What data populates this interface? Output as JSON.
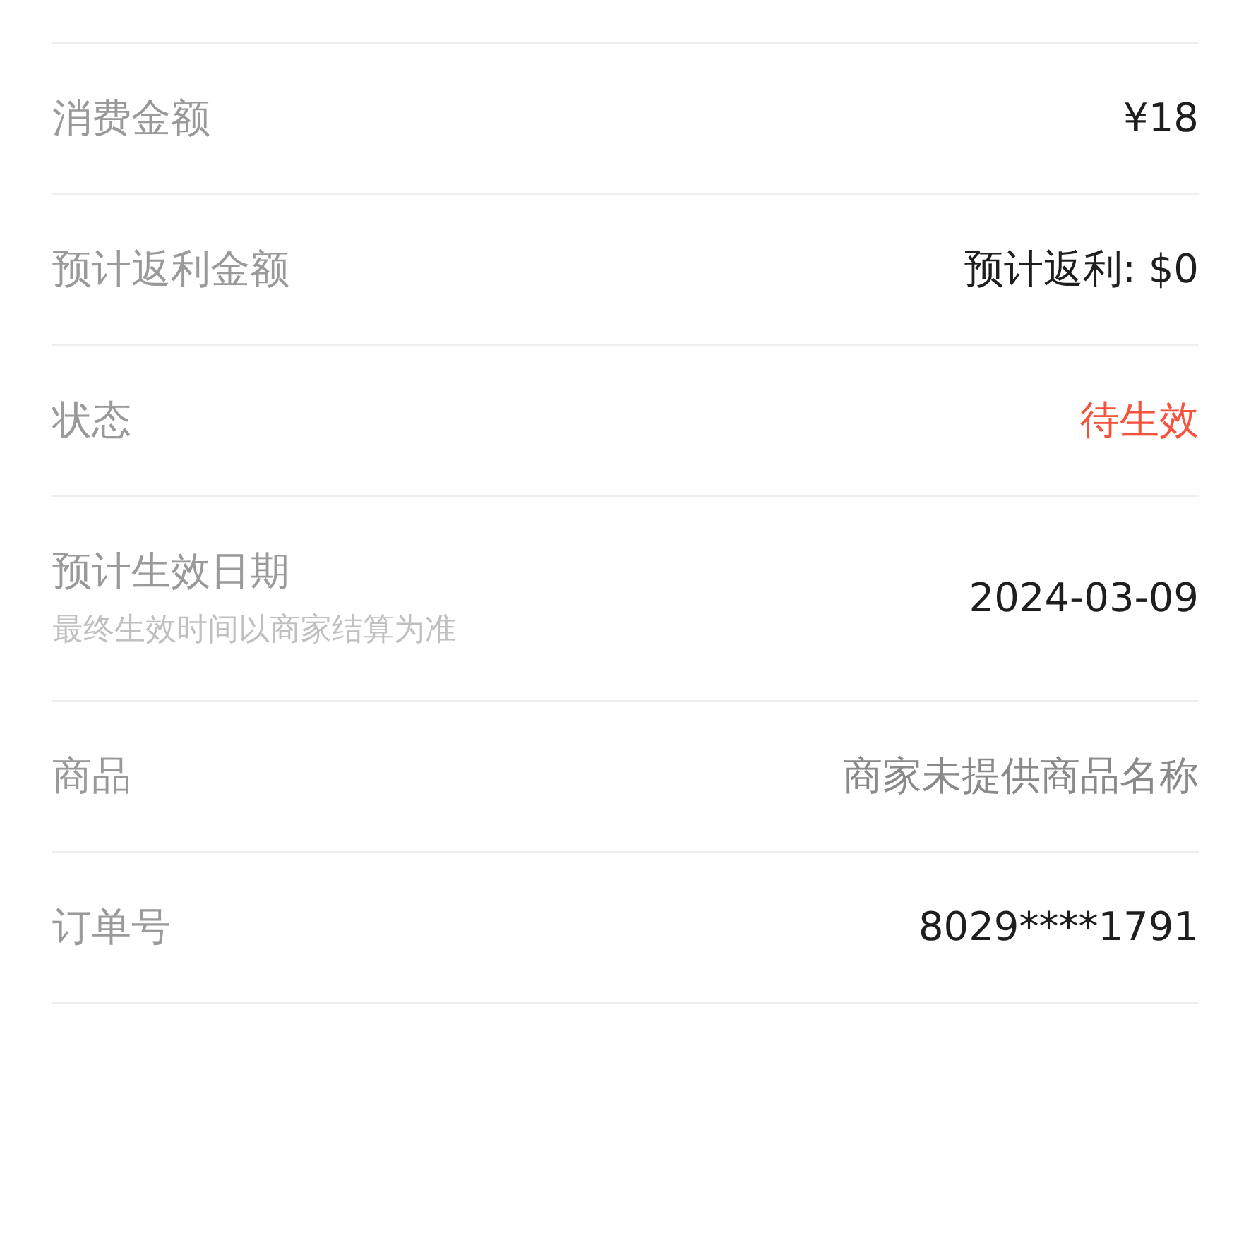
{
  "rows": [
    {
      "label": "消费金额",
      "value": "¥18",
      "kind": "plain"
    },
    {
      "label": "预计返利金额",
      "value": "预计返利: $0",
      "kind": "plain"
    },
    {
      "label": "状态",
      "value": "待生效",
      "kind": "alert"
    },
    {
      "label": "预计生效日期",
      "note": "最终生效时间以商家结算为准",
      "value": "2024-03-09",
      "kind": "plain"
    },
    {
      "label": "商品",
      "value": "商家未提供商品名称",
      "kind": "muted"
    },
    {
      "label": "订单号",
      "value": "8029****1791",
      "kind": "plain"
    }
  ]
}
